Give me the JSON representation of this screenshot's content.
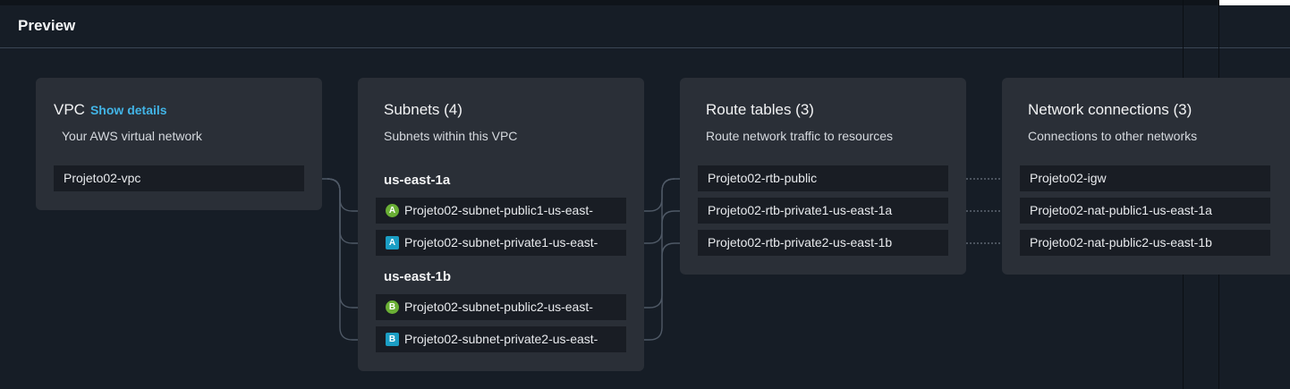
{
  "preview": {
    "title": "Preview"
  },
  "vpc": {
    "title": "VPC",
    "show_details": "Show details",
    "description": "Your AWS virtual network",
    "items": [
      "Projeto02-vpc"
    ]
  },
  "subnets": {
    "title": "Subnets (4)",
    "description": "Subnets within this VPC",
    "zones": [
      {
        "name": "us-east-1a",
        "items": [
          {
            "badge": "A",
            "kind": "public",
            "label": "Projeto02-subnet-public1-us-east-"
          },
          {
            "badge": "A",
            "kind": "private",
            "label": "Projeto02-subnet-private1-us-east-"
          }
        ]
      },
      {
        "name": "us-east-1b",
        "items": [
          {
            "badge": "B",
            "kind": "public",
            "label": "Projeto02-subnet-public2-us-east-"
          },
          {
            "badge": "B",
            "kind": "private",
            "label": "Projeto02-subnet-private2-us-east-"
          }
        ]
      }
    ]
  },
  "route_tables": {
    "title": "Route tables (3)",
    "description": "Route network traffic to resources",
    "items": [
      "Projeto02-rtb-public",
      "Projeto02-rtb-private1-us-east-1a",
      "Projeto02-rtb-private2-us-east-1b"
    ]
  },
  "network_connections": {
    "title": "Network connections (3)",
    "description": "Connections to other networks",
    "items": [
      "Projeto02-igw",
      "Projeto02-nat-public1-us-east-1a",
      "Projeto02-nat-public2-us-east-1b"
    ]
  },
  "colors": {
    "background": "#161d26",
    "card": "#2a2f37",
    "item": "#191d24",
    "link": "#42b4e6",
    "public_badge": "#6aaf35",
    "private_badge": "#1b9ec4",
    "connector": "#4f5966"
  }
}
